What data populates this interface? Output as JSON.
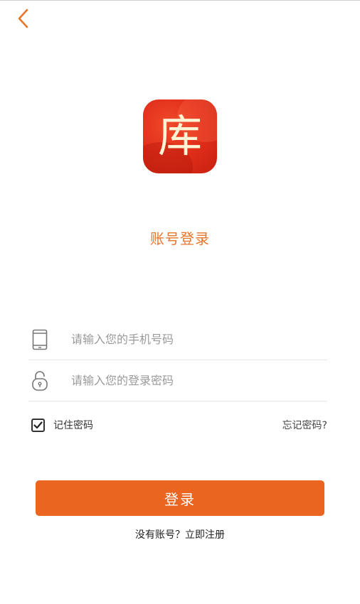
{
  "logo": {
    "char": "库"
  },
  "page": {
    "title": "账号登录"
  },
  "form": {
    "phone": {
      "placeholder": "请输入您的手机号码",
      "value": "",
      "icon": "phone-icon"
    },
    "password": {
      "placeholder": "请输入您的登录密码",
      "value": "",
      "icon": "lock-icon"
    },
    "remember": {
      "label": "记住密码",
      "checked": true
    },
    "forgot_label": "忘记密码?",
    "submit_label": "登录"
  },
  "register": {
    "text": "没有账号？立即注册"
  },
  "colors": {
    "accent": "#ea6520",
    "title": "#e8752a",
    "back": "#e8752a"
  }
}
